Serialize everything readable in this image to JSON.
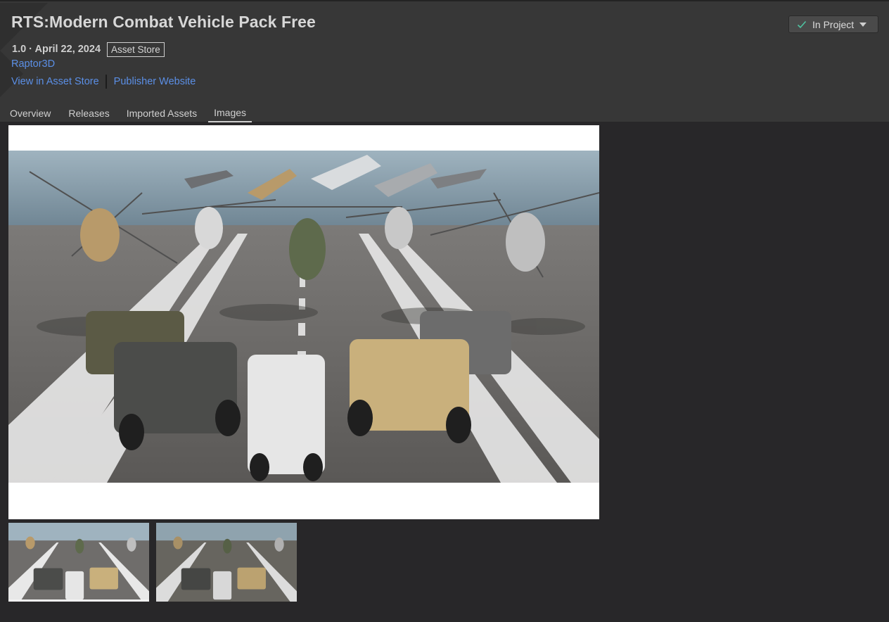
{
  "header": {
    "title": "RTS:Modern Combat Vehicle Pack Free",
    "version_date": "1.0 · April 22, 2024",
    "source_badge": "Asset Store",
    "publisher": "Raptor3D",
    "link_store": "View in Asset Store",
    "link_publisher": "Publisher Website",
    "status_button": "In Project"
  },
  "tabs": [
    {
      "label": "Overview"
    },
    {
      "label": "Releases"
    },
    {
      "label": "Imported Assets"
    },
    {
      "label": "Images"
    }
  ],
  "active_tab": "Images",
  "icons": {
    "status": "checkmark-icon",
    "dropdown": "caret-down-icon"
  },
  "colors": {
    "link": "#5b8fe6",
    "accent_check": "#4fc3a1",
    "background": "#282729",
    "header": "#373737"
  },
  "gallery": {
    "image_count": 2,
    "selected_index": 0
  }
}
